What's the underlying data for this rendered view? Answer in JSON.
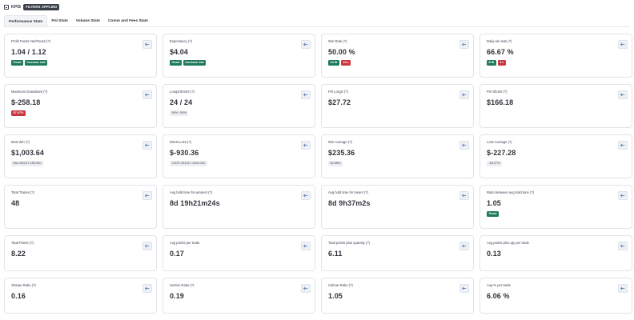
{
  "header": {
    "title": "KPIS",
    "filters_badge": "FILTERS APPLIED"
  },
  "tabs": [
    {
      "label": "Performance Stats",
      "active": true
    },
    {
      "label": "Pnl Stats"
    },
    {
      "label": "Volume Stats"
    },
    {
      "label": "Comm and Fees Stats"
    }
  ],
  "cards": [
    {
      "title": "Profit Factor Net/Gross (?)",
      "value": "1.04 / 1.12",
      "badges": [
        {
          "text": "Good",
          "color": "green"
        },
        {
          "text": "Increase risk",
          "color": "green"
        }
      ]
    },
    {
      "title": "Expectancy (?)",
      "value": "$4.04",
      "badges": [
        {
          "text": "Good",
          "color": "green"
        },
        {
          "text": "Increase risk",
          "color": "green"
        }
      ]
    },
    {
      "title": "Win Rate (?)",
      "value": "50.00 %",
      "badges": [
        {
          "text": "24 W",
          "color": "green"
        },
        {
          "text": "24 L",
          "color": "red"
        }
      ]
    },
    {
      "title": "Daily win rate (?)",
      "value": "66.67 %",
      "badges": [
        {
          "text": "8 W",
          "color": "green"
        },
        {
          "text": "4 L",
          "color": "red"
        }
      ]
    },
    {
      "title": "Maximum Drawdown (?)",
      "value": "$-258.18",
      "badges": [
        {
          "text": "97.47%",
          "color": "red"
        }
      ]
    },
    {
      "title": "Longs/Shorts (?)",
      "value": "24 / 24",
      "badges": [
        {
          "text": "50% / 50%",
          "color": "gray"
        }
      ]
    },
    {
      "title": "Pnl Longs (?)",
      "value": "$27.72",
      "badges": []
    },
    {
      "title": "Pnl Shorts (?)",
      "value": "$166.18",
      "badges": []
    },
    {
      "title": "Best Win (?)",
      "value": "$1,003.64",
      "badges": [
        {
          "text": "MU-251017-155.00C",
          "color": "gray"
        }
      ]
    },
    {
      "title": "Worst Loss (?)",
      "value": "$-930.36",
      "badges": [
        {
          "text": "COST-251017-1000.00C",
          "color": "gray"
        }
      ]
    },
    {
      "title": "Win Average (?)",
      "value": "$235.36",
      "badges": [
        {
          "text": "62.68%",
          "color": "gray"
        }
      ]
    },
    {
      "title": "Loss Average (?)",
      "value": "$-227.28",
      "badges": [
        {
          "text": "-50.57%",
          "color": "gray"
        }
      ]
    },
    {
      "title": "Total Trades (?)",
      "value": "48",
      "badges": []
    },
    {
      "title": "Avg hold time for winners (?)",
      "value": "8d 19h21m24s",
      "badges": []
    },
    {
      "title": "Avg hold time for losers (?)",
      "value": "8d 9h37m2s",
      "badges": []
    },
    {
      "title": "Ratio between avg hold time (?)",
      "value": "1.05",
      "badges": [
        {
          "text": "Good",
          "color": "green"
        }
      ]
    },
    {
      "title": "Total Points (?)",
      "value": "8.22",
      "badges": []
    },
    {
      "title": "Avg points per trade",
      "value": "0.17",
      "badges": []
    },
    {
      "title": "Total points plus quantity (?)",
      "value": "6.11",
      "badges": []
    },
    {
      "title": "Avg points plus qty per trade",
      "value": "0.13",
      "badges": []
    },
    {
      "title": "Sharpe Ratio (?)",
      "value": "0.16",
      "badges": []
    },
    {
      "title": "Sortino Ratio (?)",
      "value": "0.19",
      "badges": []
    },
    {
      "title": "Calmar Ratio (?)",
      "value": "1.05",
      "badges": []
    },
    {
      "title": "Avg % per trade",
      "value": "6.06 %",
      "badges": []
    }
  ]
}
